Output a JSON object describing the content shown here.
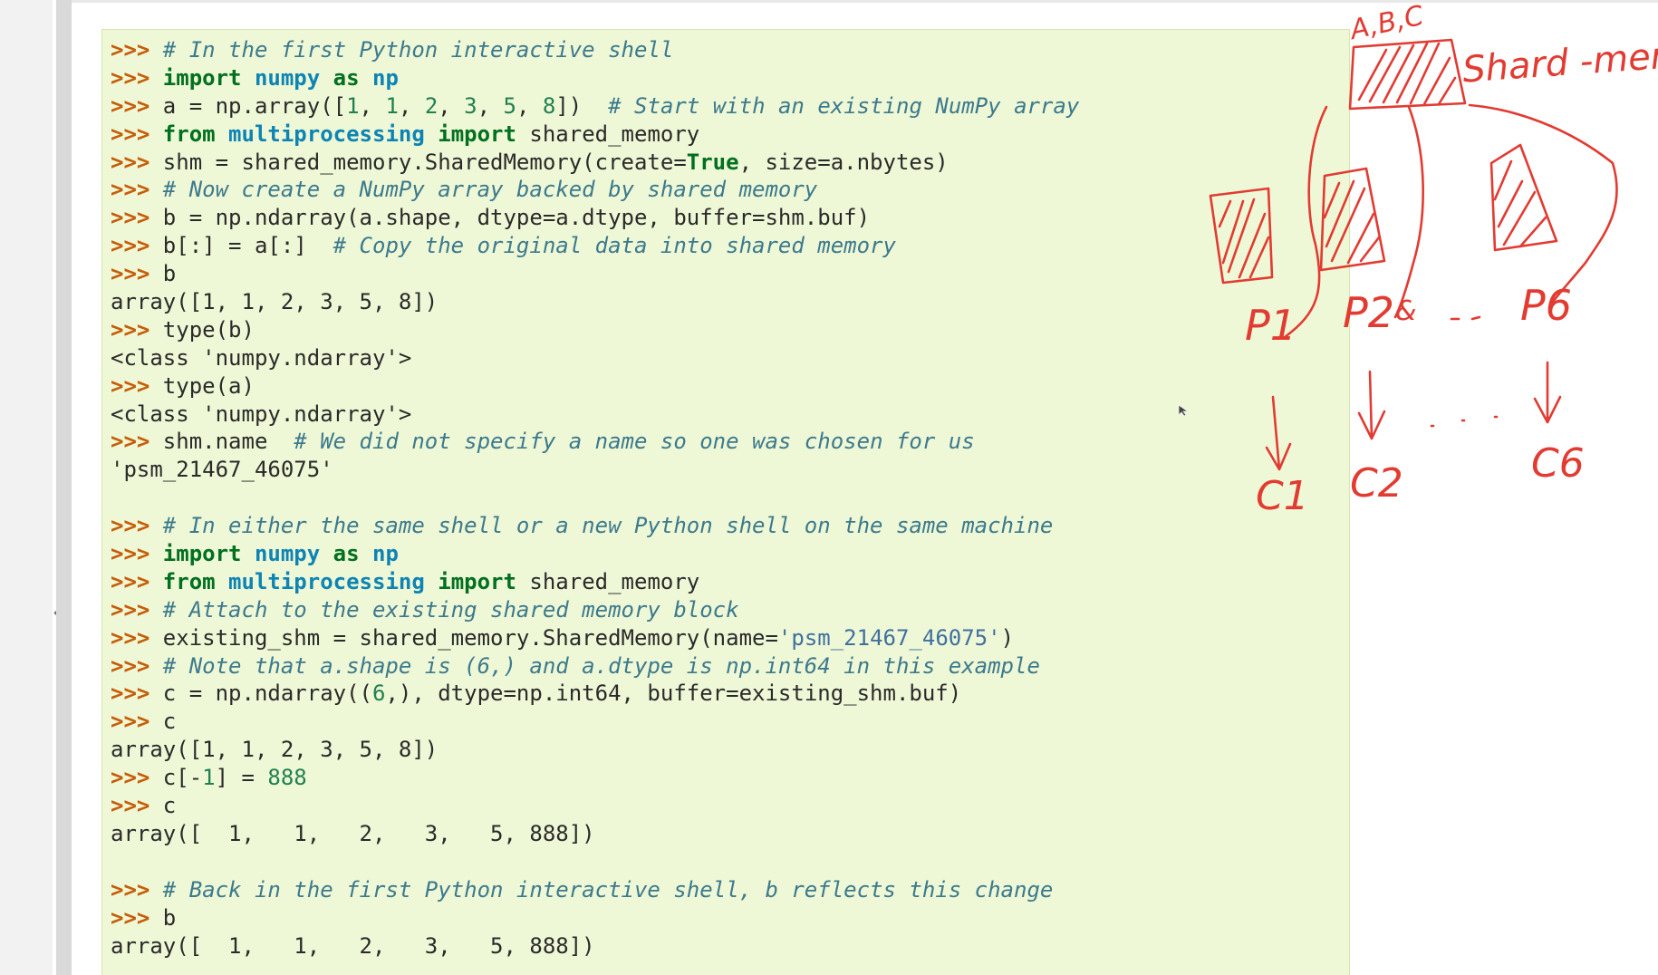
{
  "toggle": {
    "label": "«"
  },
  "code": {
    "lines": [
      [
        {
          "t": "gp",
          "v": ">>> "
        },
        {
          "t": "c",
          "v": "# In the first Python interactive shell"
        }
      ],
      [
        {
          "t": "gp",
          "v": ">>> "
        },
        {
          "t": "kw",
          "v": "import"
        },
        {
          "t": "",
          "v": " "
        },
        {
          "t": "nn",
          "v": "numpy"
        },
        {
          "t": "",
          "v": " "
        },
        {
          "t": "kw",
          "v": "as"
        },
        {
          "t": "",
          "v": " "
        },
        {
          "t": "nn",
          "v": "np"
        }
      ],
      [
        {
          "t": "gp",
          "v": ">>> "
        },
        {
          "t": "",
          "v": "a = np.array(["
        },
        {
          "t": "mi",
          "v": "1"
        },
        {
          "t": "",
          "v": ", "
        },
        {
          "t": "mi",
          "v": "1"
        },
        {
          "t": "",
          "v": ", "
        },
        {
          "t": "mi",
          "v": "2"
        },
        {
          "t": "",
          "v": ", "
        },
        {
          "t": "mi",
          "v": "3"
        },
        {
          "t": "",
          "v": ", "
        },
        {
          "t": "mi",
          "v": "5"
        },
        {
          "t": "",
          "v": ", "
        },
        {
          "t": "mi",
          "v": "8"
        },
        {
          "t": "",
          "v": "])  "
        },
        {
          "t": "c",
          "v": "# Start with an existing NumPy array"
        }
      ],
      [
        {
          "t": "gp",
          "v": ">>> "
        },
        {
          "t": "kw",
          "v": "from"
        },
        {
          "t": "",
          "v": " "
        },
        {
          "t": "nn",
          "v": "multiprocessing"
        },
        {
          "t": "",
          "v": " "
        },
        {
          "t": "kw",
          "v": "import"
        },
        {
          "t": "",
          "v": " shared_memory"
        }
      ],
      [
        {
          "t": "gp",
          "v": ">>> "
        },
        {
          "t": "",
          "v": "shm = shared_memory.SharedMemory(create="
        },
        {
          "t": "kw",
          "v": "True"
        },
        {
          "t": "",
          "v": ", size=a.nbytes)"
        }
      ],
      [
        {
          "t": "gp",
          "v": ">>> "
        },
        {
          "t": "c",
          "v": "# Now create a NumPy array backed by shared memory"
        }
      ],
      [
        {
          "t": "gp",
          "v": ">>> "
        },
        {
          "t": "",
          "v": "b = np.ndarray(a.shape, dtype=a.dtype, buffer=shm.buf)"
        }
      ],
      [
        {
          "t": "gp",
          "v": ">>> "
        },
        {
          "t": "",
          "v": "b[:] = a[:]  "
        },
        {
          "t": "c",
          "v": "# Copy the original data into shared memory"
        }
      ],
      [
        {
          "t": "gp",
          "v": ">>> "
        },
        {
          "t": "",
          "v": "b"
        }
      ],
      [
        {
          "t": "",
          "v": "array([1, 1, 2, 3, 5, 8])"
        }
      ],
      [
        {
          "t": "gp",
          "v": ">>> "
        },
        {
          "t": "",
          "v": "type(b)"
        }
      ],
      [
        {
          "t": "",
          "v": "<class 'numpy.ndarray'>"
        }
      ],
      [
        {
          "t": "gp",
          "v": ">>> "
        },
        {
          "t": "",
          "v": "type(a)"
        }
      ],
      [
        {
          "t": "",
          "v": "<class 'numpy.ndarray'>"
        }
      ],
      [
        {
          "t": "gp",
          "v": ">>> "
        },
        {
          "t": "",
          "v": "shm.name  "
        },
        {
          "t": "c",
          "v": "# We did not specify a name so one was chosen for us"
        }
      ],
      [
        {
          "t": "",
          "v": "'psm_21467_46075'"
        }
      ],
      [],
      [
        {
          "t": "gp",
          "v": ">>> "
        },
        {
          "t": "c",
          "v": "# In either the same shell or a new Python shell on the same machine"
        }
      ],
      [
        {
          "t": "gp",
          "v": ">>> "
        },
        {
          "t": "kw",
          "v": "import"
        },
        {
          "t": "",
          "v": " "
        },
        {
          "t": "nn",
          "v": "numpy"
        },
        {
          "t": "",
          "v": " "
        },
        {
          "t": "kw",
          "v": "as"
        },
        {
          "t": "",
          "v": " "
        },
        {
          "t": "nn",
          "v": "np"
        }
      ],
      [
        {
          "t": "gp",
          "v": ">>> "
        },
        {
          "t": "kw",
          "v": "from"
        },
        {
          "t": "",
          "v": " "
        },
        {
          "t": "nn",
          "v": "multiprocessing"
        },
        {
          "t": "",
          "v": " "
        },
        {
          "t": "kw",
          "v": "import"
        },
        {
          "t": "",
          "v": " shared_memory"
        }
      ],
      [
        {
          "t": "gp",
          "v": ">>> "
        },
        {
          "t": "c",
          "v": "# Attach to the existing shared memory block"
        }
      ],
      [
        {
          "t": "gp",
          "v": ">>> "
        },
        {
          "t": "",
          "v": "existing_shm = shared_memory.SharedMemory(name="
        },
        {
          "t": "s",
          "v": "'psm_21467_46075'"
        },
        {
          "t": "",
          "v": ")"
        }
      ],
      [
        {
          "t": "gp",
          "v": ">>> "
        },
        {
          "t": "c",
          "v": "# Note that a.shape is (6,) and a.dtype is np.int64 in this example"
        }
      ],
      [
        {
          "t": "gp",
          "v": ">>> "
        },
        {
          "t": "",
          "v": "c = np.ndarray(("
        },
        {
          "t": "mi",
          "v": "6"
        },
        {
          "t": "",
          "v": ",), dtype=np.int64, buffer=existing_shm.buf)"
        }
      ],
      [
        {
          "t": "gp",
          "v": ">>> "
        },
        {
          "t": "",
          "v": "c"
        }
      ],
      [
        {
          "t": "",
          "v": "array([1, 1, 2, 3, 5, 8])"
        }
      ],
      [
        {
          "t": "gp",
          "v": ">>> "
        },
        {
          "t": "",
          "v": "c[-"
        },
        {
          "t": "mi",
          "v": "1"
        },
        {
          "t": "",
          "v": "] = "
        },
        {
          "t": "mi",
          "v": "888"
        }
      ],
      [
        {
          "t": "gp",
          "v": ">>> "
        },
        {
          "t": "",
          "v": "c"
        }
      ],
      [
        {
          "t": "",
          "v": "array([  1,   1,   2,   3,   5, 888])"
        }
      ],
      [],
      [
        {
          "t": "gp",
          "v": ">>> "
        },
        {
          "t": "c",
          "v": "# Back in the first Python interactive shell, b reflects this change"
        }
      ],
      [
        {
          "t": "gp",
          "v": ">>> "
        },
        {
          "t": "",
          "v": "b"
        }
      ],
      [
        {
          "t": "",
          "v": "array([  1,   1,   2,   3,   5, 888])"
        }
      ]
    ]
  },
  "annotations": {
    "color": "#e23b32",
    "block_label": "A,B,C",
    "shared_label": "Shard -mem",
    "p1": "P1",
    "p2": "P2",
    "p2_suffix": "&",
    "p6": "P6",
    "c1": "C1",
    "c2": "C2",
    "c6": "C6"
  }
}
